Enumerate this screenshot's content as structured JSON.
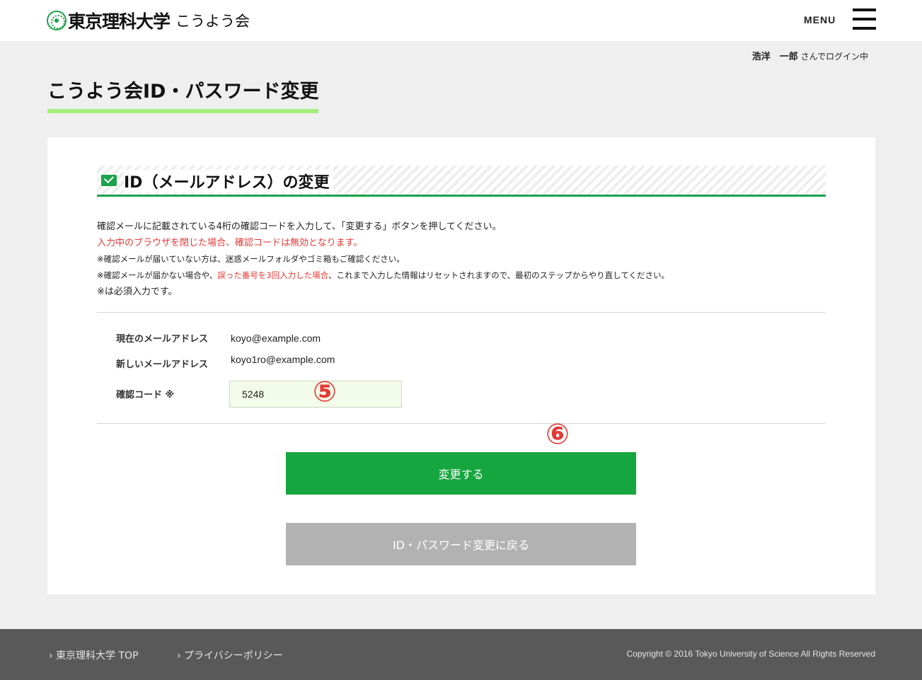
{
  "header": {
    "logo_name": "東京理科大学",
    "logo_sub": "こうよう会",
    "menu_label": "MENU"
  },
  "user": {
    "name": "浩洋　一郎",
    "suffix": "さんでログイン中"
  },
  "page_title": "こうよう会ID・パスワード変更",
  "section": {
    "title": "ID（メールアドレス）の変更",
    "notes": {
      "main": "確認メールに記載されている4桁の確認コードを入力して、「変更する」ボタンを押してください。",
      "warning": "入力中のブラウザを閉じた場合、確認コードは無効となります。",
      "note1": "※確認メールが届いていない方は、迷惑メールフォルダやゴミ箱もご確認ください。",
      "note2_pre": "※確認メールが届かない場合や、",
      "note2_red": "誤った番号を3回入力した場合",
      "note2_post": "、これまで入力した情報はリセットされますので、最初のステップからやり直してください。",
      "note3": "※は必須入力です。"
    }
  },
  "form": {
    "current_email_label": "現在のメールアドレス",
    "current_email_value": "koyo@example.com",
    "new_email_label": "新しいメールアドレス",
    "new_email_value": "koyo1ro@example.com",
    "code_label": "確認コード ※",
    "code_value": "5248"
  },
  "annotations": {
    "step5": "⑤",
    "step6": "⑥"
  },
  "buttons": {
    "submit": "変更する",
    "back": "ID・パスワード変更に戻る"
  },
  "footer": {
    "link_top": "› 東京理科大学 TOP",
    "link_privacy": "› プライバシーポリシー",
    "copyright": "Copyright © 2016 Tokyo University of Science All Rights Reserved"
  },
  "colors": {
    "accent_green": "#16a63f",
    "title_underline": "#a6ef7b",
    "warning_red": "#e53935",
    "back_button_gray": "#b2b2b2",
    "footer_bg": "#595959"
  },
  "icons": [
    "logo-emblem-icon",
    "hamburger-menu-icon",
    "envelope-icon"
  ]
}
